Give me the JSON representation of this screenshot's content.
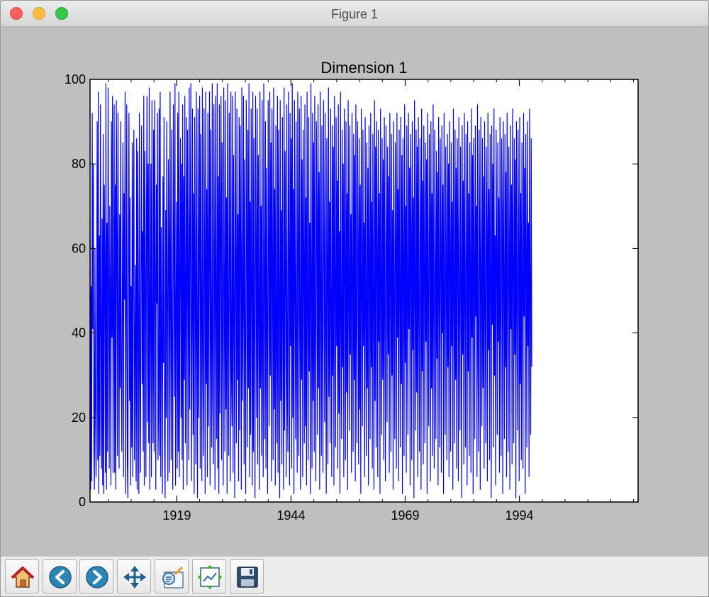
{
  "window": {
    "title": "Figure 1"
  },
  "toolbar": {
    "buttons": [
      {
        "name": "home-button",
        "icon": "home-icon"
      },
      {
        "name": "back-button",
        "icon": "back-arrow-icon"
      },
      {
        "name": "forward-button",
        "icon": "forward-arrow-icon"
      },
      {
        "name": "pan-button",
        "icon": "move-icon"
      },
      {
        "name": "zoom-button",
        "icon": "zoom-rect-icon"
      },
      {
        "name": "subplots-button",
        "icon": "subplots-icon"
      },
      {
        "name": "save-button",
        "icon": "save-icon"
      }
    ]
  },
  "chart_data": {
    "type": "line",
    "title": "Dimension 1",
    "xlabel": "",
    "ylabel": "",
    "x_tick_labels": [
      "1919",
      "1944",
      "1969",
      "1994"
    ],
    "x_range": [
      1900,
      2020
    ],
    "y_ticks": [
      0,
      20,
      40,
      60,
      80,
      100
    ],
    "ylim": [
      0,
      100
    ],
    "grid": false,
    "legend": "none",
    "color": "#0000ff",
    "series": [
      {
        "x_start": 1900,
        "x_step": 0.12,
        "values": [
          67,
          3,
          51,
          5,
          92,
          41,
          80,
          12,
          3,
          60,
          22,
          6,
          38,
          90,
          10,
          97,
          2,
          63,
          11,
          94,
          40,
          8,
          67,
          4,
          87,
          2,
          75,
          54,
          7,
          99,
          3,
          66,
          12,
          98,
          54,
          8,
          70,
          47,
          4,
          90,
          39,
          96,
          7,
          41,
          94,
          7,
          75,
          3,
          95,
          63,
          11,
          92,
          45,
          8,
          68,
          27,
          90,
          31,
          12,
          52,
          85,
          6,
          73,
          48,
          97,
          2,
          44,
          94,
          10,
          1,
          60,
          92,
          24,
          72,
          4,
          51,
          13,
          85,
          6,
          71,
          88,
          10,
          37,
          56,
          5,
          86,
          3,
          83,
          42,
          2,
          92,
          30,
          7,
          59,
          89,
          28,
          64,
          12,
          96,
          4,
          83,
          54,
          6,
          71,
          96,
          19,
          80,
          14,
          98,
          3,
          44,
          80,
          6,
          95,
          35,
          14,
          88,
          12,
          95,
          57,
          3,
          75,
          47,
          92,
          10,
          21,
          93,
          11,
          97,
          6,
          65,
          40,
          2,
          77,
          33,
          91,
          15,
          1,
          69,
          20,
          90,
          48,
          5,
          81,
          62,
          7,
          97,
          44,
          10,
          88,
          30,
          3,
          94,
          64,
          25,
          99,
          4,
          46,
          71,
          8,
          92,
          12,
          97,
          6,
          55,
          86,
          20,
          80,
          10,
          94,
          3,
          77,
          29,
          96,
          14,
          49,
          91,
          4,
          88,
          54,
          10,
          98,
          22,
          66,
          99,
          5,
          39,
          93,
          16,
          73,
          2,
          91,
          51,
          9,
          97,
          35,
          1,
          93,
          20,
          62,
          96,
          8,
          87,
          44,
          5,
          98,
          31,
          11,
          93,
          57,
          2,
          97,
          28,
          74,
          6,
          92,
          18,
          61,
          97,
          4,
          88,
          37,
          13,
          99,
          26,
          9,
          94,
          58,
          3,
          96,
          46,
          15,
          99,
          8,
          77,
          2,
          94,
          21,
          66,
          96,
          10,
          85,
          35,
          4,
          98,
          51,
          12,
          95,
          22,
          72,
          2,
          99,
          40,
          11,
          92,
          63,
          5,
          97,
          31,
          18,
          96,
          7,
          82,
          43,
          1,
          97,
          56,
          14,
          93,
          29,
          68,
          5,
          91,
          17,
          89,
          59,
          3,
          98,
          24,
          45,
          96,
          9,
          81,
          35,
          2,
          95,
          66,
          13,
          88,
          27,
          99,
          6,
          71,
          16,
          93,
          49,
          4,
          97,
          12,
          86,
          38,
          1,
          96,
          60,
          20,
          93,
          9,
          82,
          45,
          3,
          97,
          27,
          70,
          11,
          95,
          34,
          6,
          99,
          53,
          15,
          90,
          8,
          79,
          42,
          2,
          95,
          63,
          18,
          97,
          30,
          85,
          5,
          93,
          57,
          10,
          98,
          22,
          74,
          4,
          89,
          36,
          14,
          96,
          7,
          88,
          48,
          1,
          95,
          24,
          69,
          9,
          91,
          43,
          3,
          98,
          17,
          83,
          55,
          6,
          94,
          28,
          12,
          97,
          61,
          4,
          92,
          37,
          86,
          8,
          99,
          20,
          74,
          2,
          95,
          52,
          15,
          90,
          33,
          7,
          97,
          65,
          11,
          93,
          41,
          3,
          96,
          29,
          81,
          6,
          88,
          58,
          14,
          94,
          18,
          72,
          4,
          97,
          45,
          10,
          91,
          31,
          66,
          2,
          99,
          53,
          8,
          92,
          24,
          85,
          12,
          96,
          39,
          5,
          90,
          68,
          16,
          94,
          27,
          78,
          3,
          97,
          49,
          11,
          89,
          34,
          7,
          95,
          63,
          19,
          92,
          40,
          2,
          86,
          57,
          9,
          98,
          25,
          71,
          14,
          93,
          46,
          6,
          89,
          30,
          84,
          4,
          96,
          52,
          13,
          91,
          37,
          76,
          8,
          94,
          21,
          64,
          2,
          97,
          43,
          15,
          88,
          32,
          80,
          6,
          93,
          58,
          10,
          90,
          26,
          73,
          3,
          95,
          48,
          17,
          89,
          35,
          68,
          7,
          92,
          54,
          12,
          87,
          29,
          82,
          5,
          94,
          41,
          14,
          90,
          63,
          9,
          86,
          22,
          75,
          2,
          93,
          50,
          18,
          88,
          37,
          66,
          6,
          91,
          44,
          11,
          85,
          27,
          79,
          4,
          89,
          57,
          15,
          92,
          32,
          71,
          8,
          87,
          47,
          3,
          95,
          24,
          84,
          13,
          90,
          60,
          6,
          88,
          38,
          73,
          2,
          93,
          52,
          16,
          86,
          29,
          81,
          10,
          91,
          43,
          5,
          89,
          66,
          19,
          84,
          35,
          77,
          7,
          92,
          55,
          12,
          87,
          30,
          69,
          3,
          90,
          46,
          15,
          85,
          62,
          8,
          92,
          39,
          74,
          5,
          88,
          51,
          13,
          91,
          28,
          82,
          2,
          86,
          58,
          11,
          94,
          33,
          70,
          7,
          89,
          47,
          16,
          92,
          41,
          79,
          4,
          87,
          64,
          10,
          90,
          36,
          72,
          1,
          95,
          53,
          17,
          88,
          26,
          84,
          6,
          91,
          45,
          12,
          86,
          69,
          3,
          93,
          31,
          76,
          9,
          89,
          56,
          14,
          85,
          38,
          81,
          2,
          92,
          49,
          18,
          87,
          67,
          5,
          90,
          27,
          73,
          11,
          94,
          42,
          8,
          88,
          59,
          15,
          83,
          34,
          78,
          4,
          91,
          52,
          13,
          86,
          63,
          7,
          89,
          40,
          75,
          2,
          92,
          46,
          16,
          84,
          57,
          10,
          87,
          32,
          80,
          6,
          90,
          61,
          12,
          85,
          37,
          71,
          3,
          93,
          50,
          14,
          88,
          29,
          79,
          8,
          86,
          65,
          5,
          91,
          43,
          17,
          84,
          54,
          1,
          89,
          35,
          76,
          9,
          92,
          48,
          13,
          87,
          60,
          4,
          90,
          31,
          73,
          11,
          85,
          56,
          7,
          93,
          39,
          82,
          2,
          86,
          58,
          15,
          89,
          44,
          70,
          6,
          94,
          33,
          12,
          88,
          62,
          3,
          91,
          51,
          18,
          86,
          27,
          77,
          8,
          90,
          47,
          14,
          84,
          66,
          5,
          92,
          36,
          74,
          10,
          87,
          55,
          1,
          89,
          42,
          80,
          13,
          93,
          30,
          63,
          4,
          88,
          58,
          16,
          85,
          38,
          72,
          7,
          91,
          45,
          11,
          86,
          69,
          2,
          90,
          53,
          15,
          87,
          32,
          78,
          6,
          92,
          49,
          12,
          84,
          64,
          3,
          89,
          41,
          75,
          9,
          93,
          57,
          14,
          86,
          35,
          81,
          1,
          90,
          46,
          17,
          88,
          61,
          5,
          91,
          28,
          73,
          10,
          85,
          52,
          8,
          92,
          44,
          79,
          2,
          87,
          59,
          13,
          90,
          37,
          66,
          6,
          93,
          50,
          16,
          86,
          32
        ]
      }
    ]
  }
}
